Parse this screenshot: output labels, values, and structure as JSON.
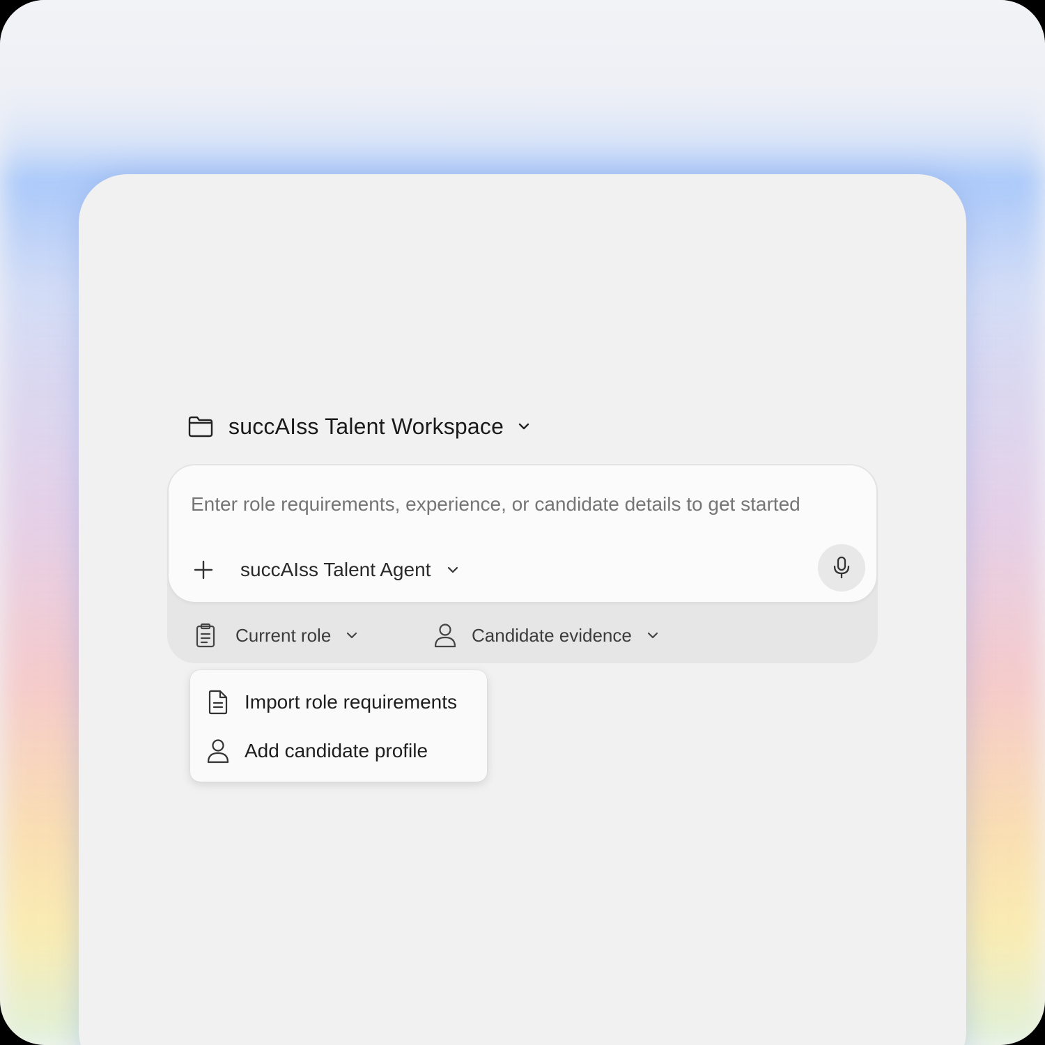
{
  "workspace": {
    "title": "succAIss Talent Workspace",
    "folder_icon": "folder-icon",
    "chevron_icon": "chevron-down-icon"
  },
  "composer": {
    "placeholder": "Enter role requirements, experience, or candidate details to get started",
    "value": "",
    "add_icon": "plus-icon",
    "agent_label": "succAIss Talent Agent",
    "mic_icon": "microphone-icon"
  },
  "context": {
    "current_role_label": "Current role",
    "current_role_icon": "clipboard-icon",
    "candidate_evidence_label": "Candidate evidence",
    "candidate_evidence_icon": "person-icon"
  },
  "menu": {
    "items": [
      {
        "label": "Import role requirements",
        "icon": "document-icon"
      },
      {
        "label": "Add candidate profile",
        "icon": "person-icon"
      }
    ]
  },
  "colors": {
    "panel": "#f1f1f1",
    "composer": "#fbfbfb",
    "tray": "#e6e6e6",
    "glow_top": "#a0c3fa",
    "glow_bottom": "#faebaa"
  }
}
